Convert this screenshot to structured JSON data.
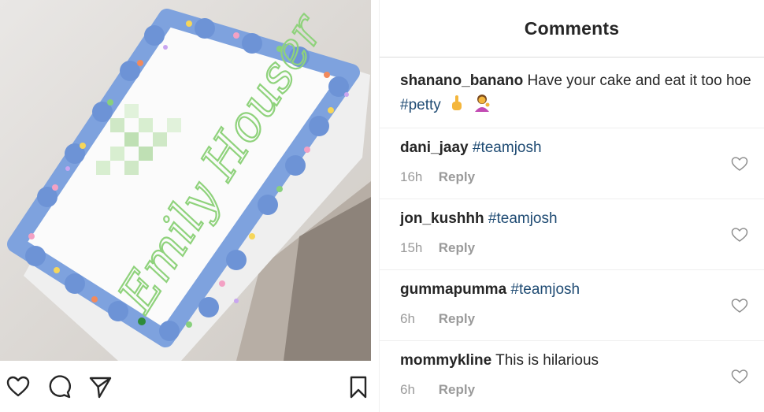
{
  "post": {
    "photo": {
      "cake_text": "Emily Houser",
      "frosting_color": "#7ea2de",
      "lettering_color": "#8fd27c"
    },
    "actions": {
      "like_icon": "heart-outline-icon",
      "comment_icon": "comment-bubble-icon",
      "share_icon": "paper-plane-icon",
      "save_icon": "bookmark-icon"
    }
  },
  "comments_panel": {
    "title": "Comments",
    "caption": {
      "username": "shanano_banano",
      "text_before": "Have your cake and eat it too hoe ",
      "hashtag": "#petty",
      "emojis": [
        "middle-finger-emoji",
        "woman-tipping-hand-emoji"
      ]
    },
    "comments": [
      {
        "username": "dani_jaay",
        "text": "",
        "hashtag": "#teamjosh",
        "time": "16h",
        "reply": "Reply"
      },
      {
        "username": "jon_kushhh",
        "text": "",
        "hashtag": "#teamjosh",
        "time": "15h",
        "reply": "Reply"
      },
      {
        "username": "gummapumma",
        "text": "",
        "hashtag": "#teamjosh",
        "time": "6h",
        "reply": "Reply"
      },
      {
        "username": "mommykline",
        "text": "This is hilarious",
        "hashtag": "",
        "time": "6h",
        "reply": "Reply"
      }
    ],
    "colors": {
      "hashtag": "#1f4b73",
      "meta": "#9a9a9a",
      "text": "#262626"
    }
  }
}
